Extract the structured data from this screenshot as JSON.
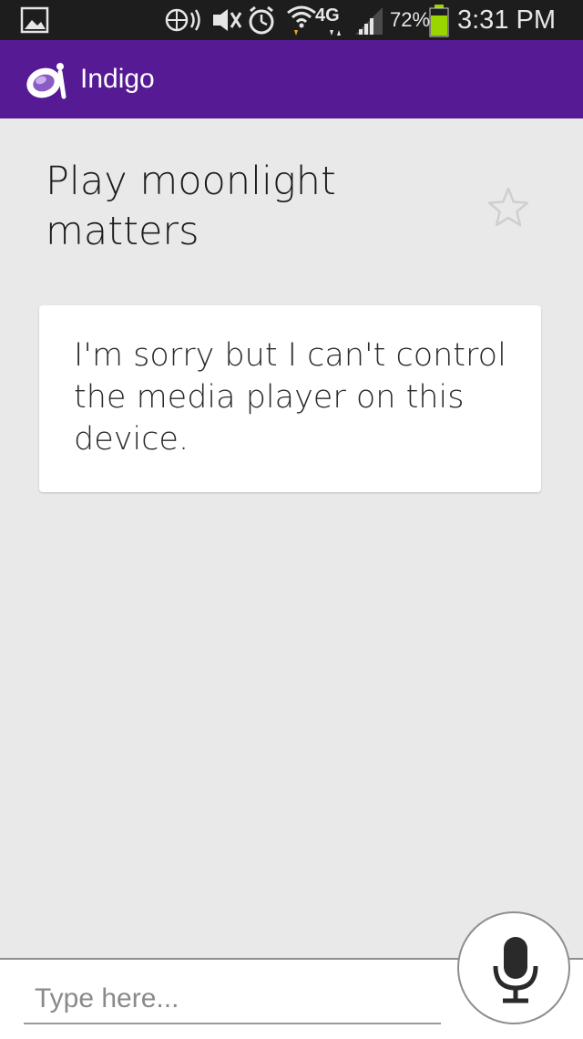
{
  "status_bar": {
    "battery_percent": "72%",
    "time": "3:31 PM",
    "network": "4G",
    "icons": [
      "image-icon",
      "nfc-icon",
      "mute-icon",
      "alarm-icon",
      "wifi-icon",
      "lte-icon",
      "signal-icon",
      "battery-icon"
    ]
  },
  "app_bar": {
    "title": "Indigo",
    "logo_icon": "indigo-logo-icon",
    "color": "#561b94"
  },
  "conversation": {
    "query": "Play moonlight matters",
    "response": "I'm sorry but I can't control the media player on this device."
  },
  "input": {
    "placeholder": "Type here..."
  },
  "icons": {
    "favorite": "star-outline-icon",
    "voice": "microphone-icon"
  }
}
